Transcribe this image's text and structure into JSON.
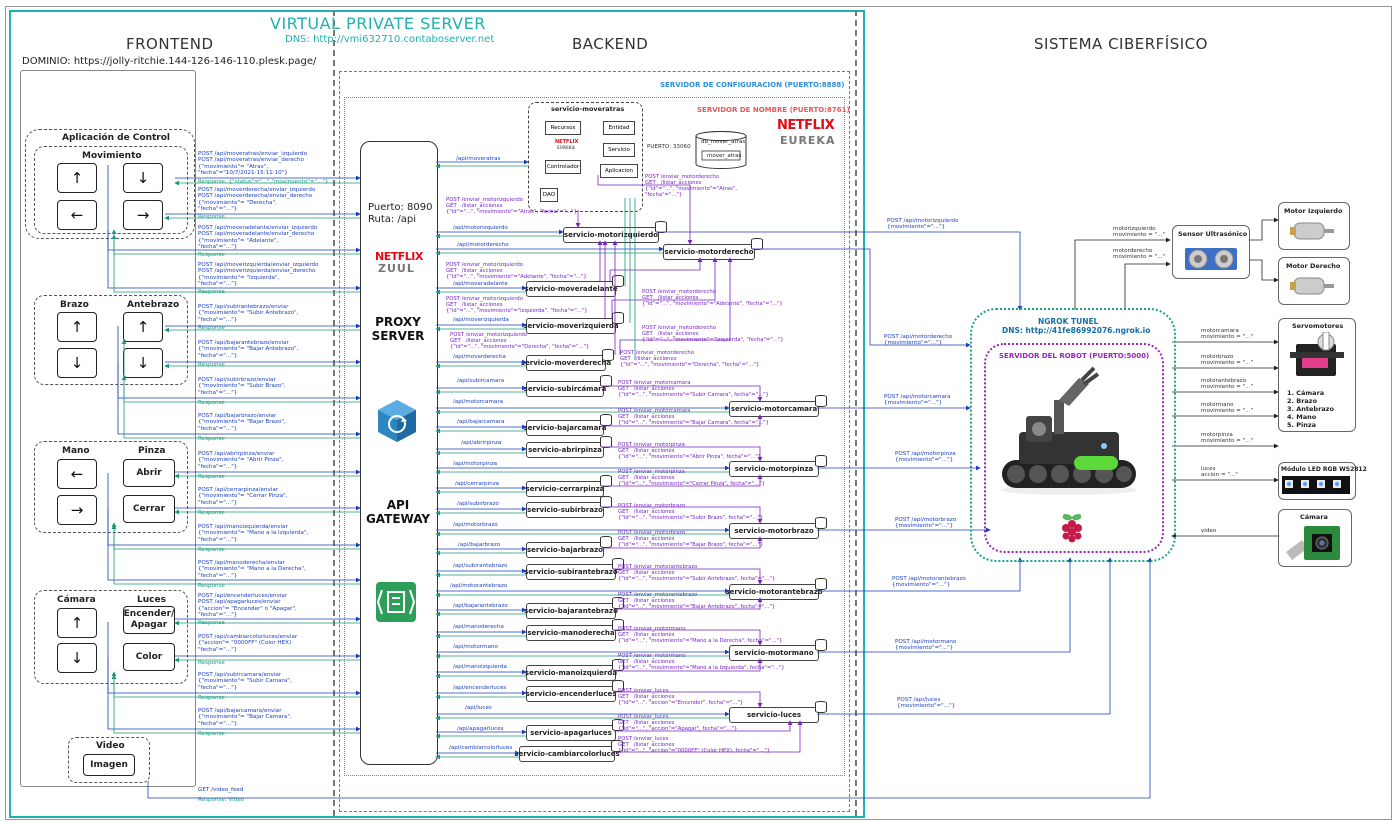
{
  "vps": {
    "title": "VIRTUAL PRIVATE SERVER",
    "dns": "DNS: http://vmi632710.contaboserver.net"
  },
  "sections": {
    "frontend": "FRONTEND",
    "backend": "BACKEND",
    "cps": "SISTEMA CIBERFÍSICO"
  },
  "domain": "DOMINIO: https://jolly-ritchie.144-126-146-110.plesk.page/",
  "frontend": {
    "app_title": "Aplicación de Control",
    "movimiento": "Movimiento",
    "brazo": "Brazo",
    "antebrazo": "Antebrazo",
    "mano": "Mano",
    "pinza": "Pinza",
    "abrir": "Abrir",
    "cerrar": "Cerrar",
    "camara": "Cámara",
    "luces": "Luces",
    "encender": "Encender/ Apagar",
    "color": "Color",
    "video": "Video",
    "imagen": "Imagen",
    "arrows": {
      "up": "↑",
      "down": "↓",
      "left": "←",
      "right": "→"
    }
  },
  "gateway": {
    "port": "Puerto: 8090",
    "route": "Ruta: /api",
    "netflix": "NETFLIX",
    "zuul": "ZUUL",
    "proxy": "PROXY SERVER",
    "api": "API GATEWAY"
  },
  "config_server": "SERVIDOR DE CONFIGURACION (PUERTO:8888)",
  "name_server": "SERVIDOR DE NOMBRE (PUERTO:8761)",
  "eureka": {
    "netflix": "NETFLIX",
    "eureka": "EUREKA"
  },
  "moveratras_box": {
    "title": "servicio-moveratras",
    "recursos": "Recursos",
    "entidad": "Entidad",
    "servicio": "Servicio",
    "controlador": "Controlador",
    "aplicacion": "Aplicacion",
    "dao": "DAO",
    "db": "db_mover_atras",
    "table": "mover_atras",
    "port": "PUERTO: 33060",
    "netflix": "NETFLIX",
    "eureka": "EUREKA"
  },
  "services": [
    {
      "name": "servicio-motorizquierdo",
      "route": "/api/motorizquierdo"
    },
    {
      "name": "servicio-motorderecho",
      "route": "/api/motorderecho"
    },
    {
      "name": "servicio-moveradelante",
      "route": "/api/moveradelante"
    },
    {
      "name": "servicio-moverizquierda",
      "route": "/api/moverizquierda"
    },
    {
      "name": "servicio-moverderecha",
      "route": "/api/moverderecha"
    },
    {
      "name": "servicio-subircámara",
      "route": "/api/subircamara"
    },
    {
      "name": "servicio-motorcamara",
      "route": "/api/motorcamara"
    },
    {
      "name": "servicio-bajarcamara",
      "route": "/api/bajarcamara"
    },
    {
      "name": "servicio-abrirpinza",
      "route": "/api/abrirpinza"
    },
    {
      "name": "servicio-motorpinza",
      "route": "/api/motorpinza"
    },
    {
      "name": "servicio-cerrarpinza",
      "route": "/api/cerrarpinza"
    },
    {
      "name": "servicio-subirbrazo",
      "route": "/api/subirbrazo"
    },
    {
      "name": "servicio-motorbrazo",
      "route": "/api/motorbrazo"
    },
    {
      "name": "servicio-bajarbrazo",
      "route": "/api/bajarbrazo"
    },
    {
      "name": "servicio-subirantebrazo",
      "route": "/api/subirantebrazo"
    },
    {
      "name": "servicio-motorantebrazo",
      "route": "/api/motorantebrazo"
    },
    {
      "name": "servicio-bajarantebrazo",
      "route": "/api/bajarantebrazo"
    },
    {
      "name": "servicio-manoderecha",
      "route": "/api/manoderecha"
    },
    {
      "name": "servicio-motormano",
      "route": "/api/motormano"
    },
    {
      "name": "servicio-manoizquierda",
      "route": "/api/manoizquierda"
    },
    {
      "name": "servicio-encenderluces",
      "route": "/api/encenderluces"
    },
    {
      "name": "servicio-luces",
      "route": "/api/luces"
    },
    {
      "name": "servicio-apagarluces",
      "route": "/api/apagarluces"
    },
    {
      "name": "servicio-cambiarcolorluces",
      "route": "/api/cambiarcolorluces"
    },
    {
      "name": "",
      "route": "/api/moveratras"
    }
  ],
  "fe_requests": [
    "POST /api/moveratras/enviar_izquierdo\nPOST /api/moveratras/enviar_derecho\n{\"movimiento\"= \"Atras\",\n\"fecha\"=\"10/7/2021-15:11:10\"}",
    "POST /api/moverderecha/enviar_izquierdo\nPOST /api/moverderecha/enviar_derecho\n{\"movimiento\"= \"Derecha\",\n\"fecha\"=\"...\"}",
    "POST /api/moveradelante/enviar_izquierdo\nPOST /api/moveradelante/enviar_derecho\n{\"movimiento\"= \"Adelante\",\n\"fecha\"=\"...\"}",
    "POST /api/moverizquierda/enviar_izquierdo\nPOST /api/moverizquierda/enviar_derecho\n{\"movimiento\"= \"Izquierda\",\n\"fecha\"=\"...\"}",
    "POST /api/subirantebrazo/enviar\n{\"movimiento\"= \"Subir Antebrazo\",\n\"fecha\"=\"...\"}",
    "POST /api/bajarantebrazo/enviar\n{\"movimiento\"= \"Bajar Antebrazo\",\n\"fecha\"=\"...\"}",
    "POST /api/subirbrazo/enviar\n{\"movimiento\"= \"Subir Brazo\",\n\"fecha\"=\"...\"}",
    "POST /api/bajarbrazo/enviar\n{\"movimiento\"= \"Bajar Brazo\",\n\"fecha\"=\"...\"}",
    "POST /api/abrirpinza/enviar\n{\"movimiento\"= \"Abrir Pinza\",\n\"fecha\"=\"...\"}",
    "POST /api/cerrarpinza/enviar\n{\"movimiento\"= \"Cerrar Pinza\",\n\"fecha\"=\"...\"}",
    "POST /api/manoizquierda/enviar\n{\"movimiento\"= \"Mano a la Izquierda\",\n\"fecha\"=\"...\"}",
    "POST /api/manoderecha/enviar\n{\"movimiento\"= \"Mano a la Derecha\",\n\"fecha\"=\"...\"}",
    "POST /api/encenderluces/enviar\nPOST /api/apagarluces/enviar\n{\"accion\"= \"Encender\" o \"Apagar\",\n\"fecha\"=\"...\"}",
    "POST /api/cambiarcolorluces/enviar\n{\"accion\"= \"0000FF\" (Color HEX)\n\"fecha\"=\"...\"}",
    "POST /api/subircamara/enviar\n{\"movimiento\"= \"Subir Camara\",\n\"fecha\"=\"...\"}",
    "POST /api/bajarcamara/enviar\n{\"movimiento\"= \"Bajar Camara\",\n\"fecha\"=\"...\"}"
  ],
  "response_label": "Response",
  "response_status": "Response: {\"status\"=\"...\",\"movimiento\"=\"...\"}",
  "video_feed": "GET /video_feed",
  "response_video": "Response: Video",
  "internal_calls": [
    "POST /enviar_motorizquierdo\nGET   /listar_acciones\n{\"id\"=\"...\", \"movimiento\"=\"Atras\", \"fecha\"=\"...\"}",
    "POST /enviar_motorderecho\nGET   /listar_acciones\n{\"id\"=\"...\", \"movimiento\"=\"Atras\",\n\"fecha\"=\"...\"}",
    "POST /enviar_motorizquierdo\nGET   /listar_acciones\n{\"id\"=\"...\", \"movimiento\"=\"Adelante\", \"fecha\"=\"...\"}",
    "POST /enviar_motorizquierdo\nGET   /listar_acciones\n{\"id\"=\"...\", \"movimiento\"=\"Izquierda\", \"fecha\"=\"...\"}",
    "POST /enviar_motorderecho\nGET   /listar_acciones\n{\"id\"=\"...\", \"movimiento\"=\"Adelante\", \"fecha\"=\"...\"}",
    "POST /enviar_motorizquierdo\nGET   /listar_acciones\n{\"id\"=\"...\", \"movimiento\"=\"Derecha\", \"fecha\"=\"...\"}",
    "POST /enviar_motorderecho\nGET   /listar_acciones\n{\"id\"=\"...\", \"movimiento\"=\"Izquierda\", \"fecha\"=\"...\"}",
    "POST /enviar_motorderecho\nGET   /listar_acciones\n{\"id\"=\"...\", \"movimiento\"=\"Derecha\", \"fecha\"=\"...\"}",
    "POST /enviar_motorcamara\nGET   /listar_acciones\n{\"id\"=\"...\", \"movimiento\"=\"Subir Camara\", fecha\"=\"...\"}",
    "POST /enviar_motorcamara\nGET   /listar_acciones\n{\"id\"=\"...\", \"movimiento\"=\"Bajar Camara\", fecha\"=\"...\"}",
    "POST /enviar_motorpinza\nGET   /listar_acciones\n{\"id\"=\"...\", \"movimiento\"=\"Abrir Pinza\", fecha\"=\"...\"}",
    "POST /enviar_motorpinza\nGET   /listar_acciones\n{\"id\"=\"...\", \"movimiento\"=\"Cerrar Pinza\", fecha\"=\"...\"}",
    "POST /enviar_motorbrazo\nGET   /listar_acciones\n{\"id\"=\"...\", \"movimiento\"=\"Subir Brazo\", fecha\"=\"...\"}",
    "POST /enviar_motorbrazo\nGET   /listar_acciones\n{\"id\"=\"...\", \"movimiento\"=\"Bajar Brazo\", fecha\"=\"...\"}",
    "POST /enviar_motorantebrazo\nGET   /listar_acciones\n{\"id\"=\"...\", \"movimiento\"=\"Subir Antebrazo\", fecha\"=\"...\"}",
    "POST /enviar_motorantebrazo\nGET   /listar_acciones\n{\"id\"=\"...\", \"movimiento\"=\"Bajar Antebrazo\", fecha\"=\"...\"}",
    "POST /enviar_motormano\nGET   /listar_acciones\n{\"id\"=\"...\", \"movimiento\"=\"Mano a la Derecha\", fecha\"=\"...\"}",
    "POST /enviar_motormano\nGET   /listar_acciones\n{\"id\"=\"...\", \"movimiento\"=\"Mano a la Izquierda\", fecha\"=\"...\"}",
    "POST /enviar_luces\nGET   /listar_acciones\n{\"id\"=\"...\", \"accion\"=\"Encender\", fecha\"=\"...\"}",
    "POST /enviar_luces\nGET   /listar_acciones\n{\"id\"=\"...\", \"accion\"=\"Apagar\", fecha\"=\"...\"}",
    "POST /enviar_luces\nGET   /listar_acciones\n{\"id\"=\"...\", \"accion\"=\"0000FF\" (Color HEX), fecha\"=\"...\"}"
  ],
  "robot_calls": [
    "POST /api/motorizquierdo\n{movimiento\"=\"...\"}",
    "POST /api/motorderecho\n{movimiento\"=\"...\"}",
    "POST /api/motorcamara\n{movimiento\"=\"...\"}",
    "POST /api/motorpinza\n{movimiento\"=\"...\"}",
    "POST /api/motorbrazo\n{movimiento\"=\"...\"}",
    "POST /api/motorantebrazo\n{movimiento\"=\"...\"}",
    "POST /api/motormano\n{movimiento\"=\"...\"}",
    "POST /api/luces\n{movimiento\"=\"...\"}"
  ],
  "ngrok": {
    "title": "NGROK TUNEL",
    "dns": "DNS: http://41fe86992076.ngrok.io",
    "server": "SERVIDOR DEL ROBOT (PUERTO:5000)"
  },
  "hardware": {
    "sensor": "Sensor Ultrasónico",
    "motor_izq": "Motor Izquierdo",
    "motor_der": "Motor Derecho",
    "servos": "Servomotores",
    "servo_list": [
      "1. Cámara",
      "2. Brazo",
      "3. Antebrazo",
      "4. Mano",
      "5. Pinza"
    ],
    "led": "Módulo LED RGB WS2812",
    "camera": "Cámara"
  },
  "hw_labels": {
    "motorizq": "motorizquierdo\nmovimiento = \"...\"",
    "motorder": "motorderecho\nmovimiento = \"...\"",
    "motorcamara": "motorcamara\nmovimiento = \"...\"",
    "motorbrazo": "motorbrazo\nmovimiento = \"...\"",
    "motorantebrazo": "motorantebrazo\nmovimiento = \"...\"",
    "motormano": "motormano\nmovimiento = \"...\"",
    "motorpinza": "motorpinza\nmovimiento = \"...\"",
    "luces": "luces\naccion = \"...\"",
    "video": "video"
  },
  "colors": {
    "vps": "#1fb2b2",
    "config": "#2b8fd8",
    "name": "#e05a5a",
    "ngrok": "#1aa58a",
    "robot": "#9a24b8",
    "request": "#1a3fbf",
    "response": "#1a9a7a",
    "internal": "#7a22c4",
    "netflix": "#e50914"
  },
  "icons": [
    "arrow-up-icon",
    "arrow-down-icon",
    "arrow-left-icon",
    "arrow-right-icon",
    "sync-icon",
    "api-gateway-icon",
    "database-icon",
    "raspberry-pi-icon",
    "robot-icon",
    "motor-icon",
    "servo-icon",
    "led-strip-icon",
    "camera-icon",
    "ultrasonic-sensor-icon",
    "folder-icon"
  ]
}
